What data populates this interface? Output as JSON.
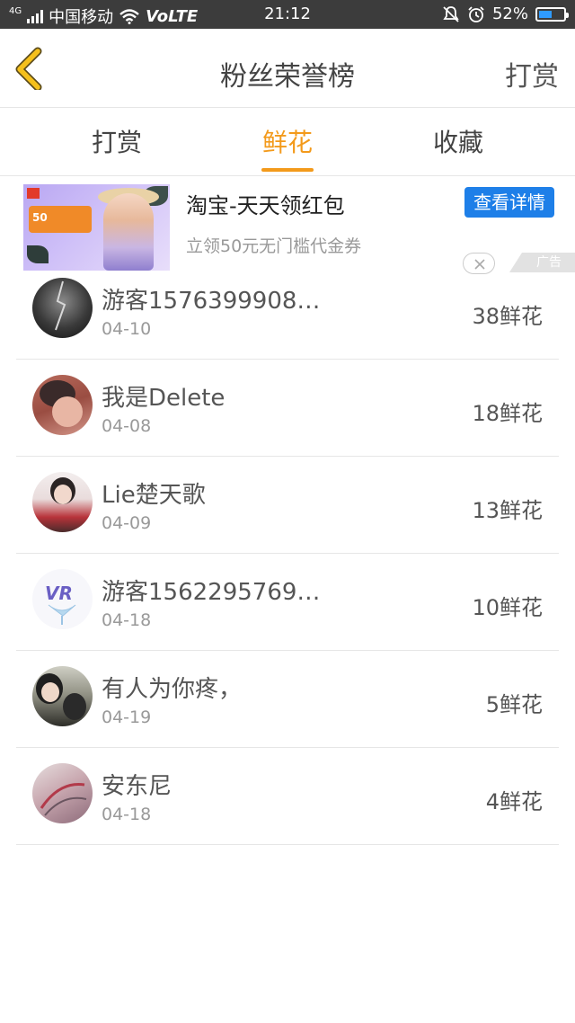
{
  "status_bar": {
    "network": "4G",
    "carrier": "中国移动",
    "volte": "VoLTE",
    "time": "21:12",
    "battery_percent": "52%",
    "battery_level": 0.52,
    "icons": [
      "signal-icon",
      "wifi-icon",
      "mute-bell-icon",
      "alarm-icon",
      "battery-icon"
    ]
  },
  "header": {
    "title": "粉丝荣誉榜",
    "action_label": "打赏",
    "back_icon": "chevron-left-icon",
    "accent_color": "#f5c01c"
  },
  "tabs": [
    {
      "label": "打赏",
      "active": false
    },
    {
      "label": "鲜花",
      "active": true
    },
    {
      "label": "收藏",
      "active": false
    }
  ],
  "tab_accent_color": "#f39a1b",
  "ad": {
    "title": "淘宝-天天领红包",
    "description": "立领50元无门槛代金券",
    "button_label": "查看详情",
    "badge": "广告",
    "image_text": "50",
    "button_color": "#1e7fe8"
  },
  "fans": [
    {
      "name": "游客1576399908…",
      "date": "04-10",
      "flowers": "38鲜花"
    },
    {
      "name": "我是Delete",
      "date": "04-08",
      "flowers": "18鲜花"
    },
    {
      "name": "Lie楚天歌",
      "date": "04-09",
      "flowers": "13鲜花"
    },
    {
      "name": "游客1562295769…",
      "date": "04-18",
      "flowers": "10鲜花"
    },
    {
      "name": "有人为你疼，",
      "date": "04-19",
      "flowers": "5鲜花"
    },
    {
      "name": "安东尼",
      "date": "04-18",
      "flowers": "4鲜花"
    }
  ]
}
